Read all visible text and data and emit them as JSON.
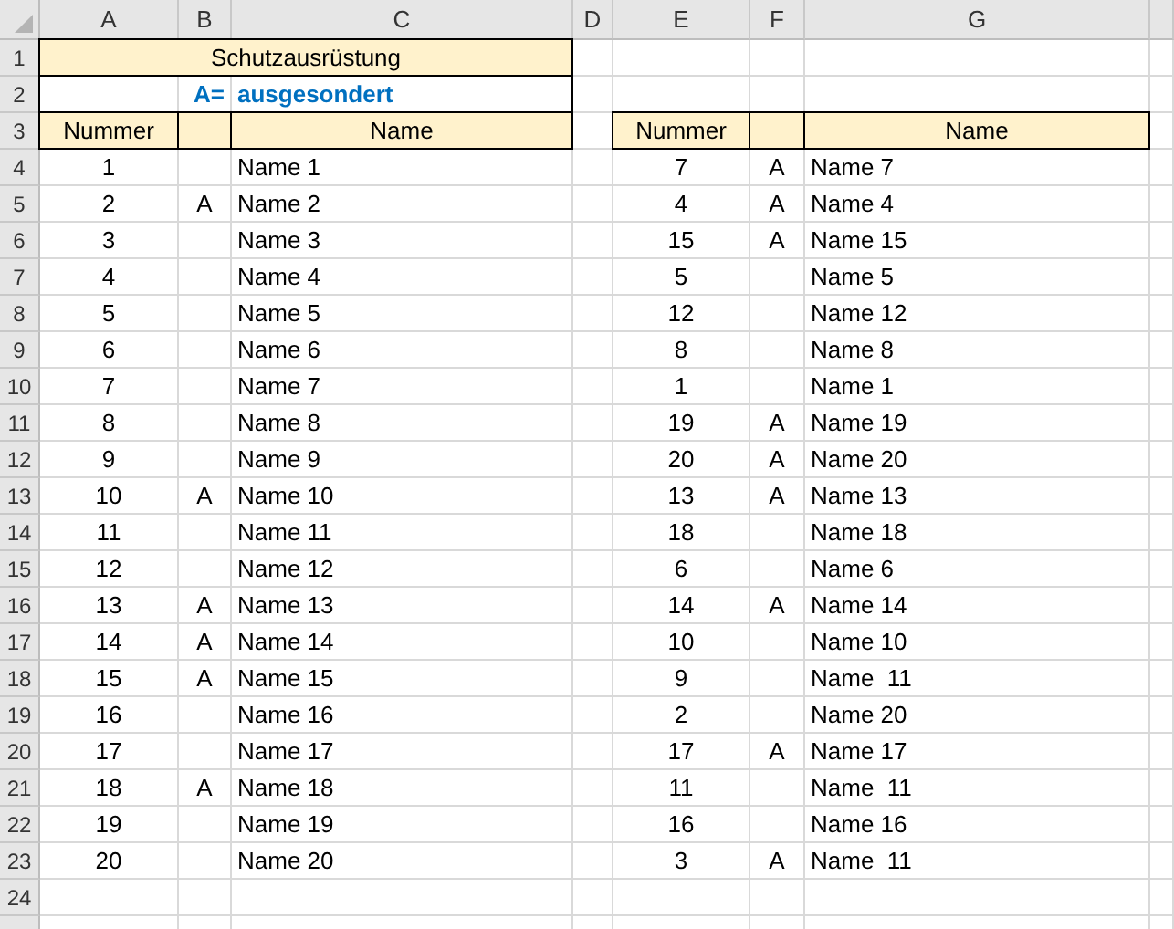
{
  "column_headers": [
    "A",
    "B",
    "C",
    "D",
    "E",
    "F",
    "G"
  ],
  "row_headers": [
    "1",
    "2",
    "3",
    "4",
    "5",
    "6",
    "7",
    "8",
    "9",
    "10",
    "11",
    "12",
    "13",
    "14",
    "15",
    "16",
    "17",
    "18",
    "19",
    "20",
    "21",
    "22",
    "23",
    "24"
  ],
  "title": "Schutzausrüstung",
  "legend": {
    "key": "A=",
    "label": "ausgesondert"
  },
  "left_table": {
    "columns": [
      "Nummer",
      "Name"
    ],
    "rows": [
      {
        "number": "1",
        "name": "Name 1"
      },
      {
        "number": "2",
        "flag": "A",
        "name": "Name 2"
      },
      {
        "number": "3",
        "name": "Name 3"
      },
      {
        "number": "4",
        "name": "Name 4"
      },
      {
        "number": "5",
        "name": "Name 5"
      },
      {
        "number": "6",
        "name": "Name 6"
      },
      {
        "number": "7",
        "name": "Name 7"
      },
      {
        "number": "8",
        "name": "Name 8"
      },
      {
        "number": "9",
        "name": "Name 9"
      },
      {
        "number": "10",
        "flag": "A",
        "name": "Name 10"
      },
      {
        "number": "11",
        "name": "Name 11"
      },
      {
        "number": "12",
        "name": "Name 12"
      },
      {
        "number": "13",
        "flag": "A",
        "name": "Name 13"
      },
      {
        "number": "14",
        "flag": "A",
        "name": "Name 14"
      },
      {
        "number": "15",
        "flag": "A",
        "name": "Name 15"
      },
      {
        "number": "16",
        "name": "Name 16"
      },
      {
        "number": "17",
        "name": "Name 17"
      },
      {
        "number": "18",
        "flag": "A",
        "name": "Name 18"
      },
      {
        "number": "19",
        "name": "Name 19"
      },
      {
        "number": "20",
        "name": "Name 20"
      }
    ]
  },
  "right_table": {
    "columns": [
      "Nummer",
      "Name"
    ],
    "rows": [
      {
        "number": "7",
        "flag": "A",
        "name": "Name 7"
      },
      {
        "number": "4",
        "flag": "A",
        "name": "Name 4"
      },
      {
        "number": "15",
        "flag": "A",
        "name": "Name 15"
      },
      {
        "number": "5",
        "name": "Name 5"
      },
      {
        "number": "12",
        "name": "Name 12"
      },
      {
        "number": "8",
        "name": "Name 8"
      },
      {
        "number": "1",
        "name": "Name 1"
      },
      {
        "number": "19",
        "flag": "A",
        "name": "Name 19"
      },
      {
        "number": "20",
        "flag": "A",
        "name": "Name 20"
      },
      {
        "number": "13",
        "flag": "A",
        "name": "Name 13"
      },
      {
        "number": "18",
        "name": "Name 18"
      },
      {
        "number": "6",
        "name": "Name 6"
      },
      {
        "number": "14",
        "flag": "A",
        "name": "Name 14"
      },
      {
        "number": "10",
        "name": "Name 10"
      },
      {
        "number": "9",
        "name": "Name  11"
      },
      {
        "number": "2",
        "name": "Name 20"
      },
      {
        "number": "17",
        "flag": "A",
        "name": "Name 17"
      },
      {
        "number": "11",
        "name": "Name  11"
      },
      {
        "number": "16",
        "name": "Name 16"
      },
      {
        "number": "3",
        "flag": "A",
        "name": "Name  11"
      }
    ]
  }
}
